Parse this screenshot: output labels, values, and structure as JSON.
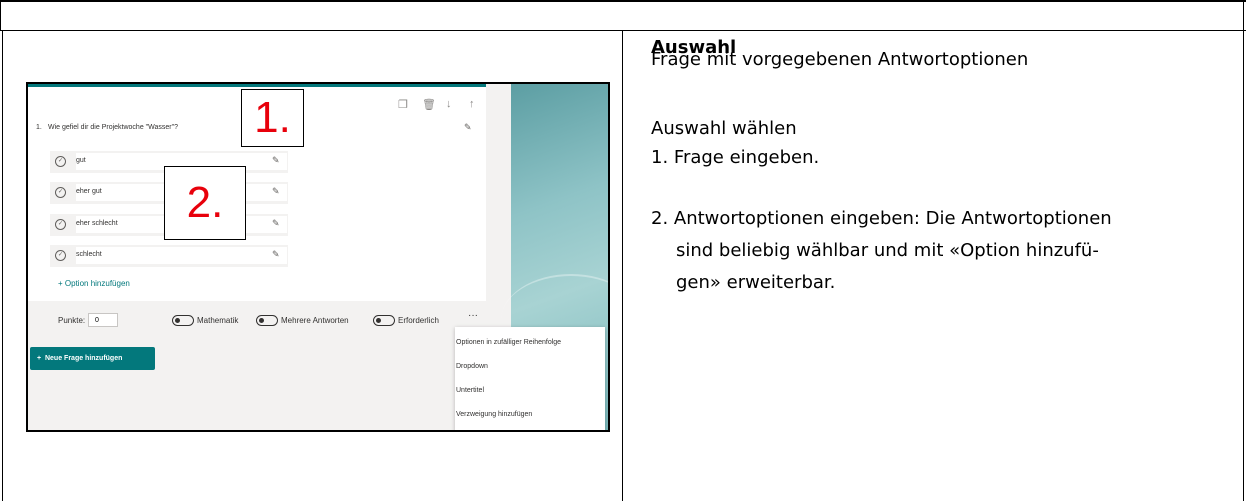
{
  "screenshot": {
    "toolbar_icons": [
      "copy-icon",
      "trash-icon",
      "arrow-down-icon",
      "arrow-up-icon"
    ],
    "question_number": "1.",
    "question_text": "Wie gefiel dir die Projektwoche \"Wasser\"?",
    "options": [
      "gut",
      "eher gut",
      "eher schlecht",
      "schlecht"
    ],
    "add_option_label": "Option hinzufügen",
    "points_label": "Punkte:",
    "points_value": "0",
    "toggle_math": "Mathematik",
    "toggle_multi": "Mehrere Antworten",
    "toggle_required": "Erforderlich",
    "more_label": "···",
    "new_question_label": "Neue Frage hinzufügen",
    "menu_items": [
      "Optionen in zufälliger Reihenfolge",
      "Dropdown",
      "Untertitel",
      "Verzweigung hinzufügen"
    ],
    "marker_1": "1.",
    "marker_2": "2."
  },
  "description": {
    "heading": "Auswahl",
    "subtitle": "Frage mit vorgegebenen Antwortoptionen",
    "steps_title": "Auswahl wählen",
    "step1": "1.  Frage eingeben.",
    "step2_line1": "2.  Antwortoptionen eingeben: Die Antwortoptionen",
    "step2_line2": "sind beliebig wählbar und mit «Option hinzufü-",
    "step2_line3": "gen» erweiterbar."
  }
}
